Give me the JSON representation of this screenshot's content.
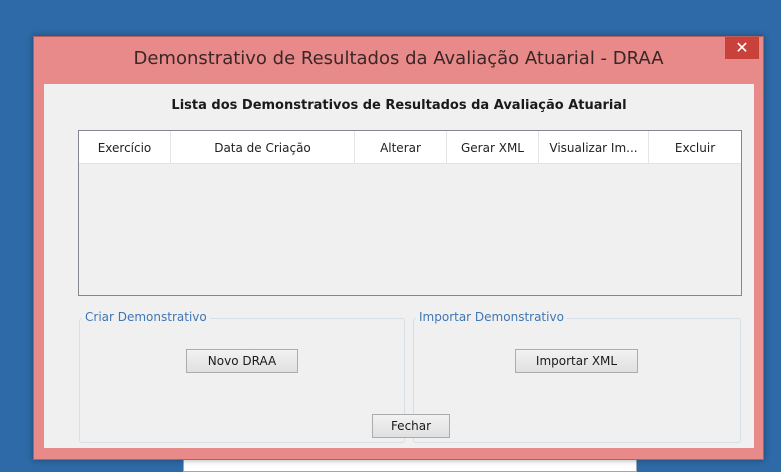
{
  "window": {
    "title": "Demonstrativo de Resultados da Avaliação Atuarial - DRAA",
    "close_symbol": "✕"
  },
  "heading": "Lista dos Demonstrativos de Resultados da Avaliação Atuarial",
  "table": {
    "columns": [
      "Exercício",
      "Data de Criação",
      "Alterar",
      "Gerar XML",
      "Visualizar Im...",
      "Excluir"
    ],
    "rows": []
  },
  "create_group": {
    "legend": "Criar Demonstrativo",
    "button_label": "Novo DRAA"
  },
  "import_group": {
    "legend": "Importar Demonstrativo",
    "button_label": "Importar XML"
  },
  "close_button_label": "Fechar",
  "colors": {
    "desktop": "#2d6aa7",
    "window_frame": "#e88a8a",
    "close_button": "#c8413b",
    "group_legend": "#3e76b4"
  }
}
